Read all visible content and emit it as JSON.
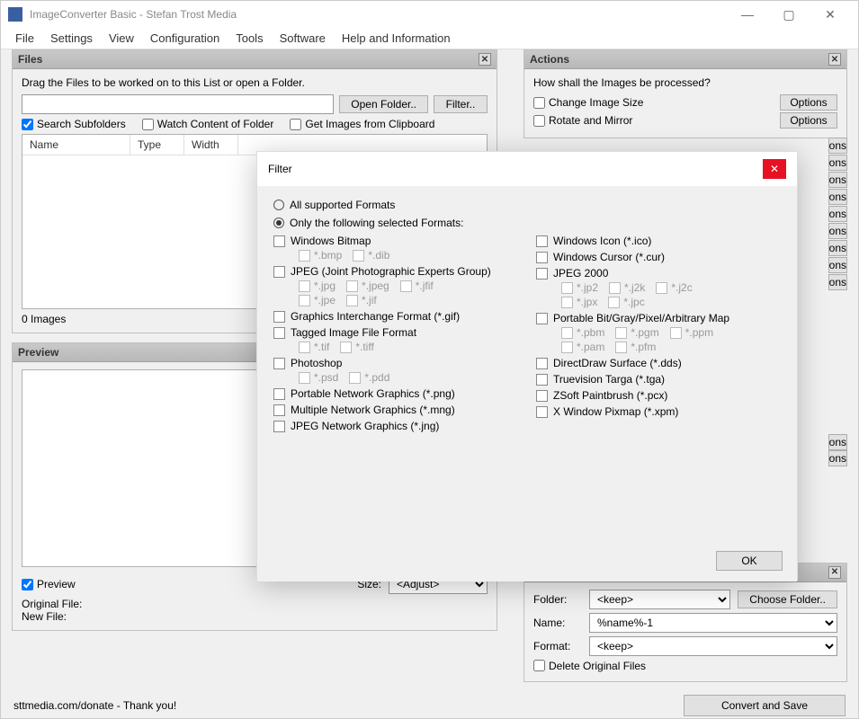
{
  "window": {
    "title": "ImageConverter Basic - Stefan Trost Media"
  },
  "menu": [
    "File",
    "Settings",
    "View",
    "Configuration",
    "Tools",
    "Software",
    "Help and Information"
  ],
  "files_panel": {
    "title": "Files",
    "drag_label": "Drag the Files to be worked on to this List or open a Folder.",
    "open_folder_btn": "Open Folder..",
    "filter_btn": "Filter..",
    "search_subfolders": "Search Subfolders",
    "watch_content": "Watch Content of Folder",
    "clipboard": "Get Images from Clipboard",
    "columns": [
      "Name",
      "Type",
      "Width"
    ],
    "count": "0 Images"
  },
  "preview_panel": {
    "title": "Preview",
    "preview_cb": "Preview",
    "size_label": "Size:",
    "size_value": "<Adjust>",
    "orig_label": "Original File:",
    "new_label": "New File:"
  },
  "actions_panel": {
    "title": "Actions",
    "question": "How shall the Images be processed?",
    "items": [
      "Change Image Size",
      "Rotate and Mirror"
    ],
    "options_btn": "Options"
  },
  "saving_panel": {
    "folder_label": "Folder:",
    "folder_value": "<keep>",
    "choose_folder_btn": "Choose Folder..",
    "name_label": "Name:",
    "name_value": "%name%-1",
    "format_label": "Format:",
    "format_value": "<keep>",
    "delete_orig": "Delete Original Files"
  },
  "footer": {
    "donate": "sttmedia.com/donate - Thank you!",
    "convert_btn": "Convert and Save"
  },
  "modal": {
    "title": "Filter",
    "radio_all": "All supported Formats",
    "radio_selected": "Only the following selected Formats:",
    "ok": "OK",
    "left": [
      {
        "name": "Windows Bitmap",
        "exts": [
          "*.bmp",
          "*.dib"
        ]
      },
      {
        "name": "JPEG (Joint Photographic Experts Group)",
        "exts": [
          "*.jpg",
          "*.jpeg",
          "*.jfif",
          "*.jpe",
          "*.jif"
        ]
      },
      {
        "name": "Graphics Interchange Format (*.gif)",
        "exts": []
      },
      {
        "name": "Tagged Image File Format",
        "exts": [
          "*.tif",
          "*.tiff"
        ]
      },
      {
        "name": "Photoshop",
        "exts": [
          "*.psd",
          "*.pdd"
        ]
      },
      {
        "name": "Portable Network Graphics (*.png)",
        "exts": []
      },
      {
        "name": "Multiple Network Graphics (*.mng)",
        "exts": []
      },
      {
        "name": "JPEG Network Graphics (*.jng)",
        "exts": []
      }
    ],
    "right": [
      {
        "name": "Windows Icon (*.ico)",
        "exts": []
      },
      {
        "name": "Windows Cursor (*.cur)",
        "exts": []
      },
      {
        "name": "JPEG 2000",
        "exts": [
          "*.jp2",
          "*.j2k",
          "*.j2c",
          "*.jpx",
          "*.jpc"
        ]
      },
      {
        "name": "Portable Bit/Gray/Pixel/Arbitrary Map",
        "exts": [
          "*.pbm",
          "*.pgm",
          "*.ppm",
          "*.pam",
          "*.pfm"
        ]
      },
      {
        "name": "DirectDraw Surface (*.dds)",
        "exts": []
      },
      {
        "name": "Truevision Targa (*.tga)",
        "exts": []
      },
      {
        "name": "ZSoft Paintbrush (*.pcx)",
        "exts": []
      },
      {
        "name": "X Window Pixmap (*.xpm)",
        "exts": []
      }
    ]
  },
  "partial_options_count": 9
}
